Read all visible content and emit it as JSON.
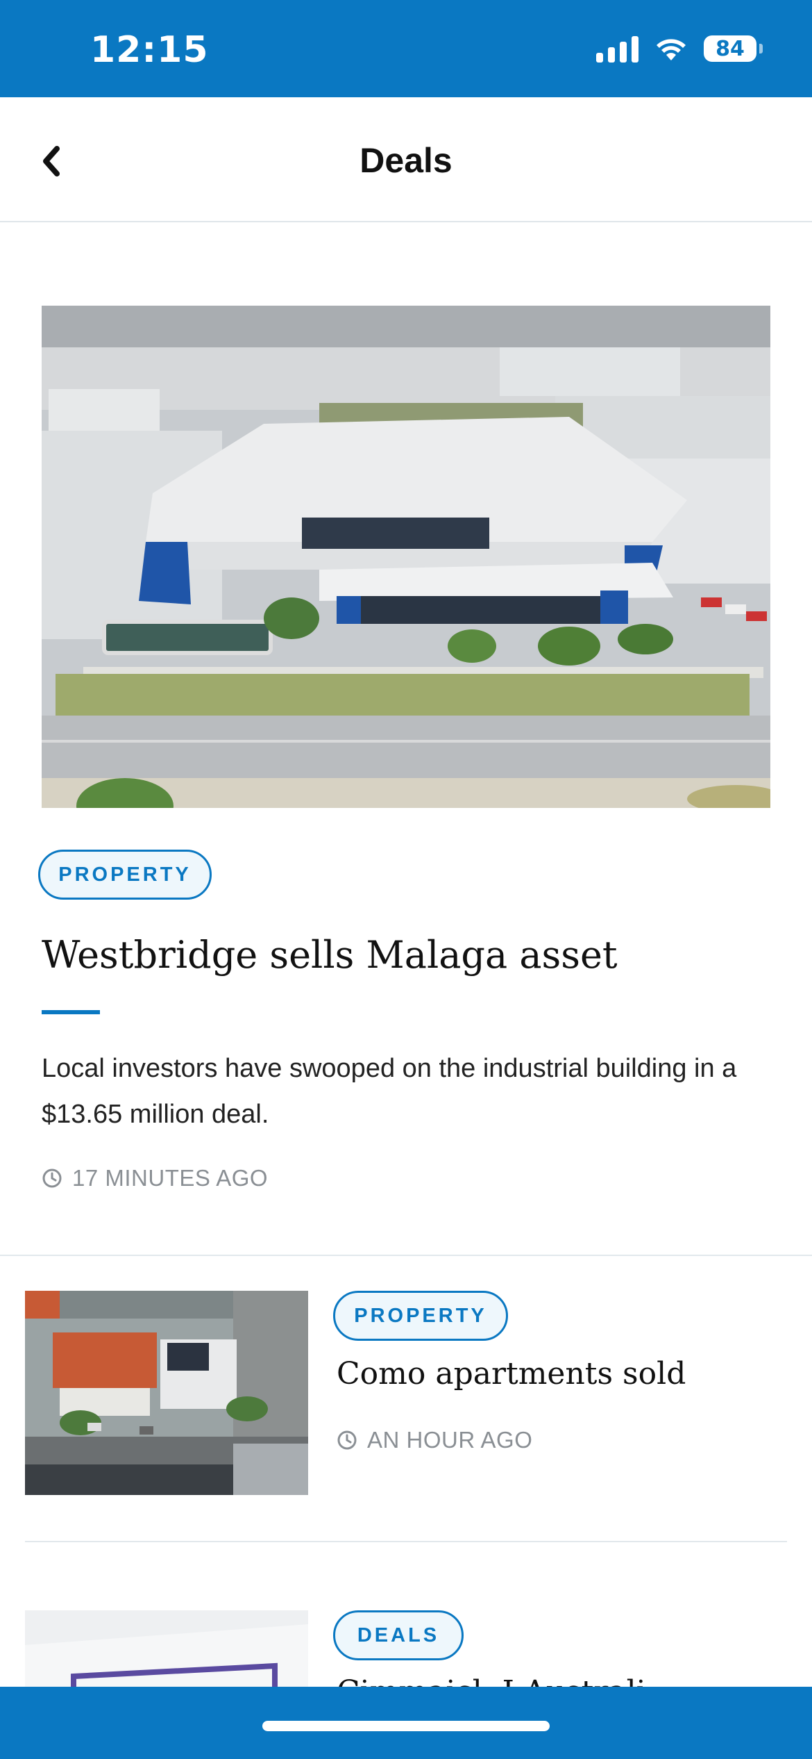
{
  "status_bar": {
    "time": "12:15",
    "battery": "84"
  },
  "nav": {
    "title": "Deals"
  },
  "featured": {
    "tag": "PROPERTY",
    "title": "Westbridge sells Malaga asset",
    "summary": "Local investors have swooped on the industrial building in a $13.65 million deal.",
    "time": "17 MINUTES AGO"
  },
  "articles": [
    {
      "tag": "PROPERTY",
      "title": "Como apartments sold",
      "time": "AN HOUR AGO"
    },
    {
      "tag": "DEALS",
      "title": "Cimmajcl: I Australi",
      "time": ""
    }
  ],
  "colors": {
    "brand": "#0a78c2",
    "tag_bg": "#eef7fc",
    "meta_text": "#8a8f94"
  },
  "icons": [
    "back-chevron-icon",
    "clock-icon",
    "signal-icon",
    "wifi-icon",
    "battery-icon"
  ]
}
